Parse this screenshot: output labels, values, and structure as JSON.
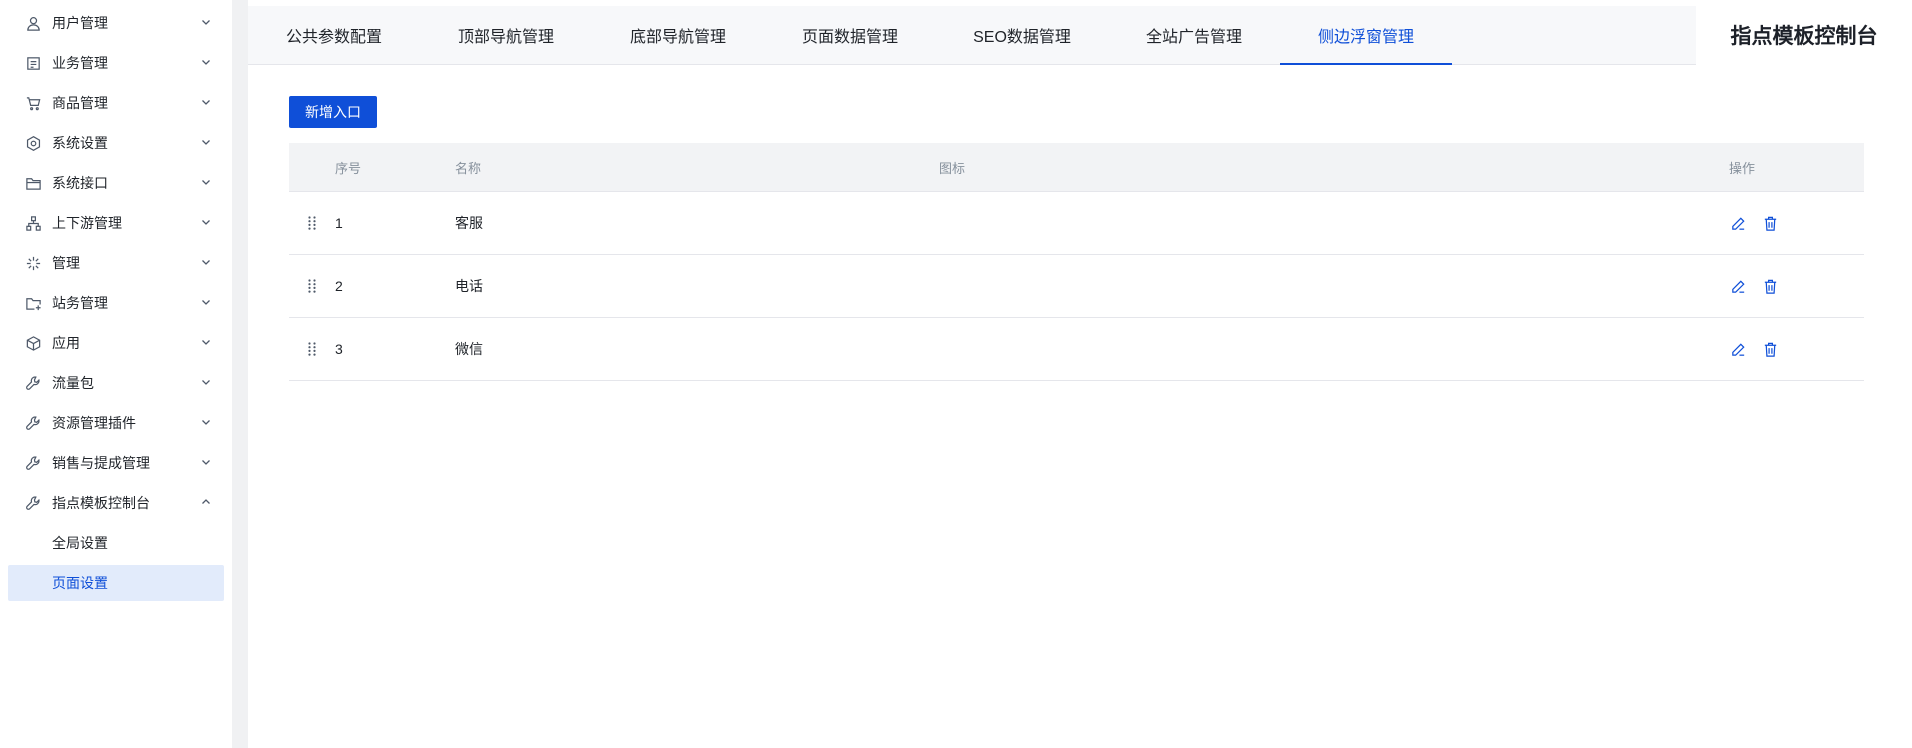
{
  "sidebar": {
    "items": [
      {
        "label": "用户管理",
        "icon": "user-icon"
      },
      {
        "label": "业务管理",
        "icon": "document-icon"
      },
      {
        "label": "商品管理",
        "icon": "cart-icon"
      },
      {
        "label": "系统设置",
        "icon": "hexagon-gear-icon"
      },
      {
        "label": "系统接口",
        "icon": "folder-icon"
      },
      {
        "label": "上下游管理",
        "icon": "hierarchy-icon"
      },
      {
        "label": "管理",
        "icon": "sparkle-icon"
      },
      {
        "label": "站务管理",
        "icon": "folder-add-icon"
      },
      {
        "label": "应用",
        "icon": "cube-icon"
      },
      {
        "label": "流量包",
        "icon": "wrench-icon"
      },
      {
        "label": "资源管理插件",
        "icon": "wrench-icon"
      },
      {
        "label": "销售与提成管理",
        "icon": "wrench-icon"
      },
      {
        "label": "指点模板控制台",
        "icon": "wrench-icon",
        "expanded": true
      }
    ],
    "sub_items": [
      {
        "label": "全局设置"
      },
      {
        "label": "页面设置",
        "active": true
      }
    ]
  },
  "tabs": [
    {
      "label": "公共参数配置"
    },
    {
      "label": "顶部导航管理"
    },
    {
      "label": "底部导航管理"
    },
    {
      "label": "页面数据管理"
    },
    {
      "label": "SEO数据管理"
    },
    {
      "label": "全站广告管理"
    },
    {
      "label": "侧边浮窗管理",
      "active": true
    }
  ],
  "console_title": "指点模板控制台",
  "toolbar": {
    "add_label": "新增入口"
  },
  "table": {
    "headers": {
      "no": "序号",
      "name": "名称",
      "icon": "图标",
      "ops": "操作"
    },
    "rows": [
      {
        "no": "1",
        "name": "客服"
      },
      {
        "no": "2",
        "name": "电话"
      },
      {
        "no": "3",
        "name": "微信"
      }
    ]
  },
  "colors": {
    "accent": "#0f4fd8",
    "active_bg": "#e2ebfb",
    "header_bg": "#f2f3f5"
  }
}
